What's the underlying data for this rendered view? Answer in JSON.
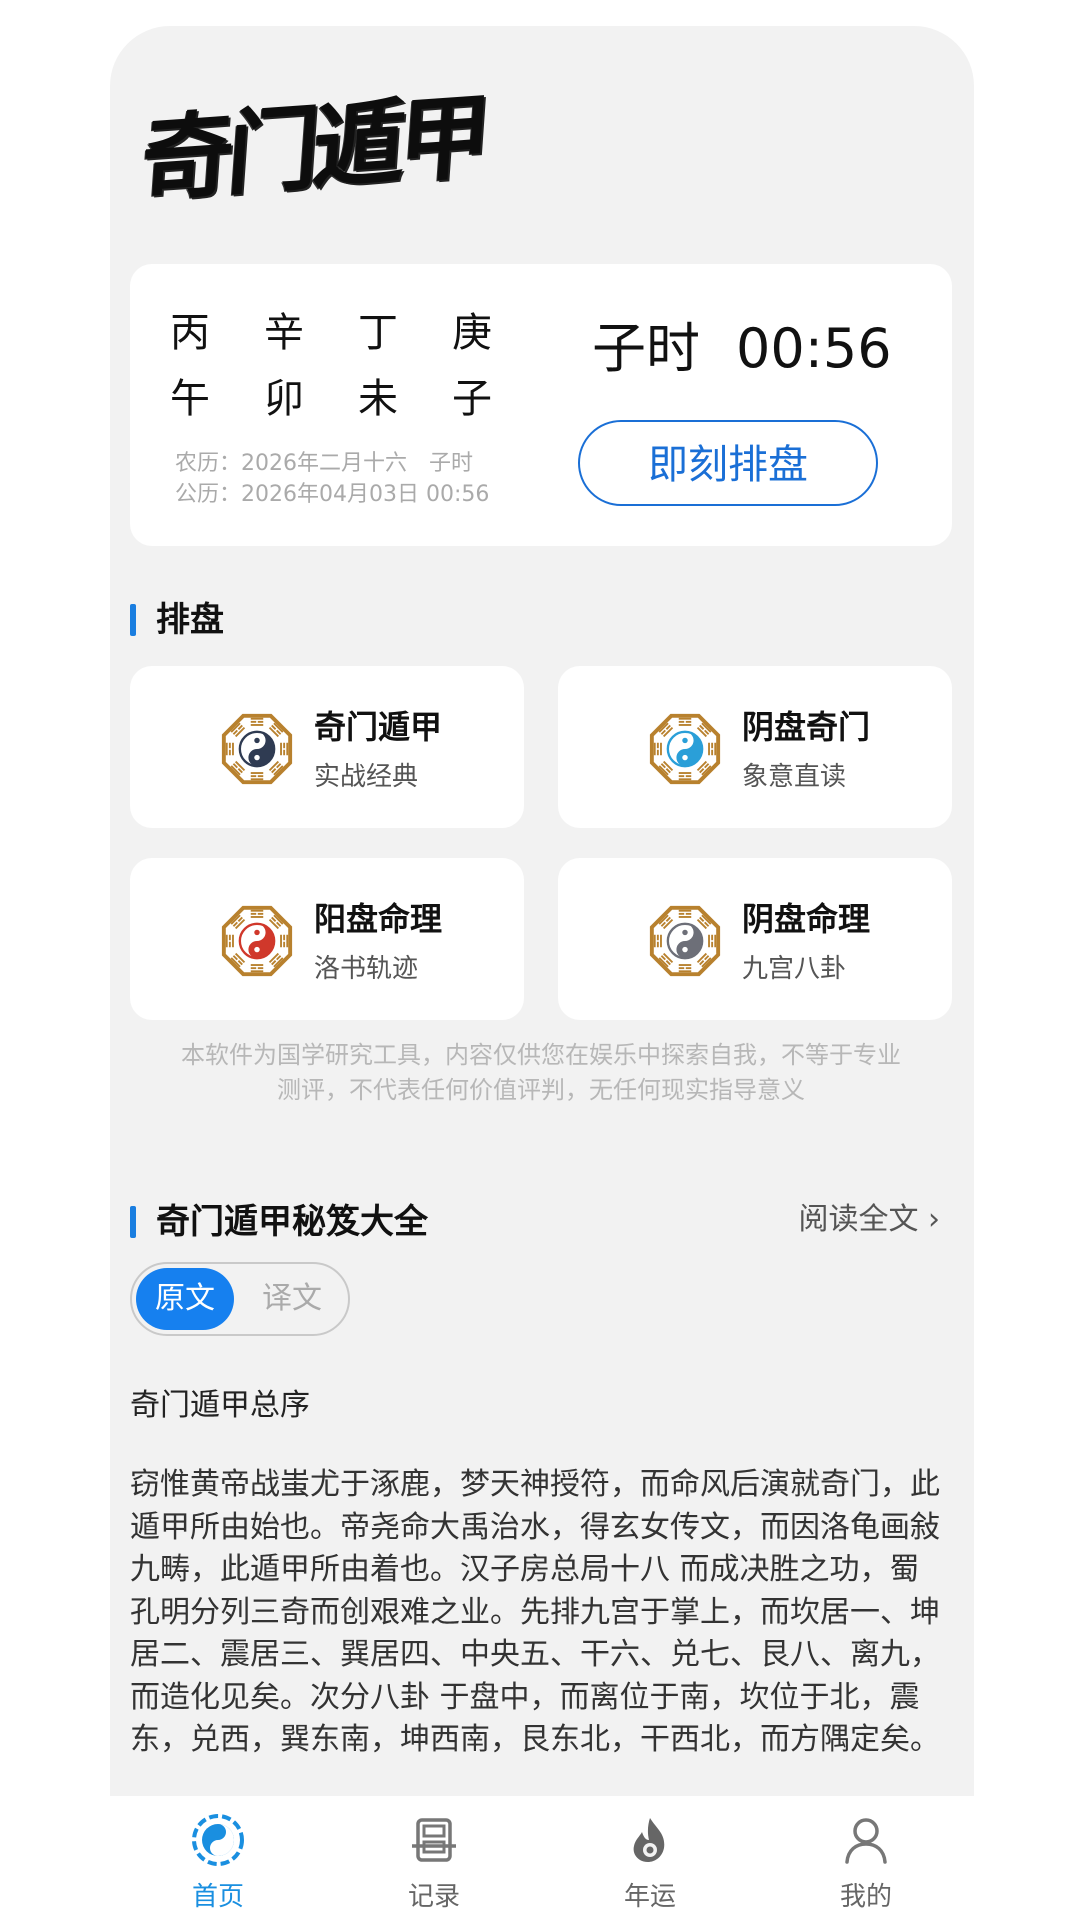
{
  "app": {
    "logo_text": "奇门遁甲"
  },
  "date_card": {
    "ganzhi_top": [
      "丙",
      "辛",
      "丁",
      "庚"
    ],
    "ganzhi_bottom": [
      "午",
      "卯",
      "未",
      "子"
    ],
    "lunar": "农历：2026年二月十六　子时",
    "solar": "公历：2026年04月03日 00:56",
    "shichen": "子时",
    "clock": "00:56",
    "button_label": "即刻排盘"
  },
  "paipan": {
    "title": "排盘",
    "items": [
      {
        "title": "奇门遁甲",
        "subtitle": "实战经典",
        "icon": "bagua-taiji-icon",
        "accent": "#2f3b52"
      },
      {
        "title": "阴盘奇门",
        "subtitle": "象意直读",
        "icon": "bagua-taiji-icon",
        "accent": "#2a9fd8"
      },
      {
        "title": "阳盘命理",
        "subtitle": "洛书轨迹",
        "icon": "bagua-taiji-icon",
        "accent": "#d0382b"
      },
      {
        "title": "阴盘命理",
        "subtitle": "九宫八卦",
        "icon": "bagua-taiji-icon",
        "accent": "#6d6f78"
      }
    ]
  },
  "disclaimer": {
    "line1": "本软件为国学研究工具，内容仅供您在娱乐中探索自我，不等于专业",
    "line2": "测评，不代表任何价值评判，无任何现实指导意义"
  },
  "book": {
    "title": "奇门遁甲秘笈大全",
    "read_all": "阅读全文 ›",
    "toggle_on": "原文",
    "toggle_off": "译文",
    "article_title": "奇门遁甲总序",
    "article_body": "窃惟黄帝战蚩尤于涿鹿，梦天神授符，而命风后演就奇门，此遁甲所由始也。帝尧命大禹治水，得玄女传文，而因洛龟画敍九畴，此遁甲所由着也。汉子房总局十八 而成决胜之功，蜀孔明分列三奇而创艰难之业。先排九宫于掌上，而坎居一、坤居二、震居三、巽居四、中央五、干六、兑七、艮八、离九，而造化见矣。次分八卦 于盘中，而离位于南，坎位于北，震东，兑西，巽东南，坤西南，艮东北，干西北，而方隅定矣。"
  },
  "tabbar": {
    "items": [
      {
        "label": "首页",
        "icon": "yin-yang-home-icon",
        "active": true
      },
      {
        "label": "记录",
        "icon": "record-icon",
        "active": false
      },
      {
        "label": "年运",
        "icon": "flame-icon",
        "active": false
      },
      {
        "label": "我的",
        "icon": "user-icon",
        "active": false
      }
    ]
  },
  "colors": {
    "accent": "#1a7ee0",
    "background": "#f2f2f2",
    "bagua_gold": "#b8812e"
  }
}
